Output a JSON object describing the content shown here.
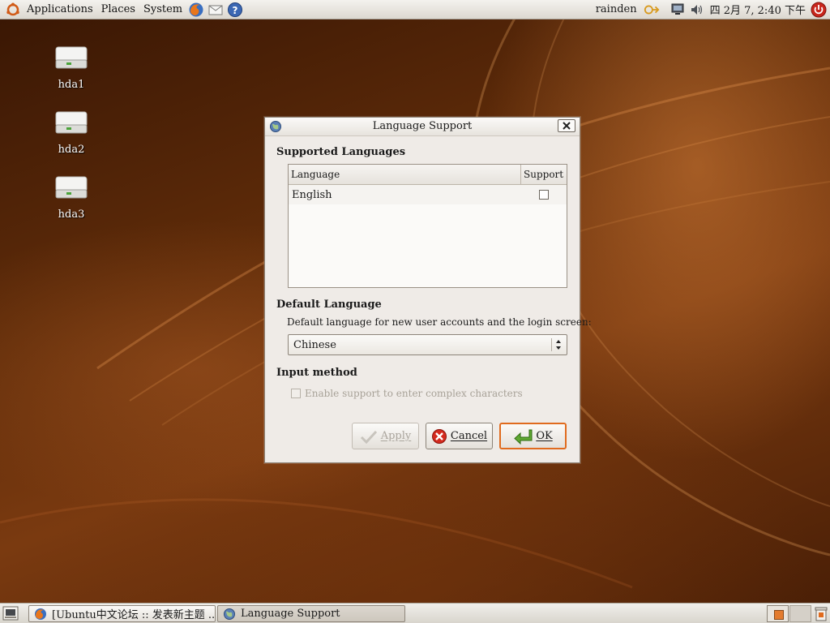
{
  "top_panel": {
    "menus": [
      "Applications",
      "Places",
      "System"
    ],
    "user": "rainden",
    "clock": "四 2月 7, 2:40 下午"
  },
  "desktop": {
    "icons": [
      {
        "label": "hda1"
      },
      {
        "label": "hda2"
      },
      {
        "label": "hda3"
      }
    ]
  },
  "dialog": {
    "title": "Language Support",
    "supported_heading": "Supported Languages",
    "table": {
      "columns": [
        "Language",
        "Support"
      ],
      "rows": [
        {
          "language": "English",
          "supported": false
        }
      ]
    },
    "default_heading": "Default Language",
    "default_desc": "Default language for new user accounts and the login screen:",
    "default_value": "Chinese",
    "input_heading": "Input method",
    "input_checkbox_label": "Enable support to enter complex characters",
    "buttons": {
      "apply": "Apply",
      "cancel": "Cancel",
      "ok": "OK"
    }
  },
  "taskbar": {
    "tasks": [
      {
        "label": "[Ubuntu中文论坛 :: 发表新主题 ..."
      },
      {
        "label": "Language Support"
      }
    ]
  },
  "colors": {
    "accent": "#e06b1e",
    "wallpaper": "#5e2b09",
    "panel": "#e8e4dd"
  }
}
